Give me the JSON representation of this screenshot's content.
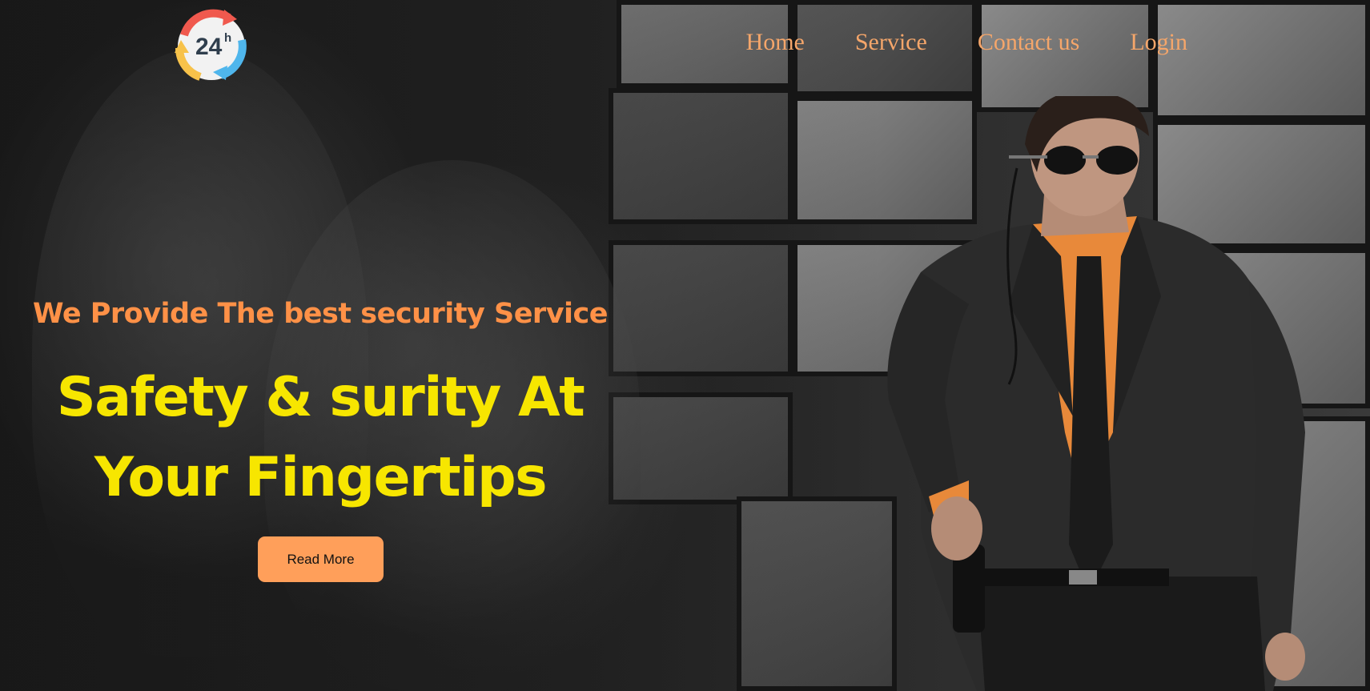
{
  "header": {
    "logo": {
      "text": "24",
      "superscript": "h",
      "icon": "24h-cycle-arrows-icon",
      "colors": {
        "red": "#f0594e",
        "blue": "#4fb6ec",
        "yellow": "#f7c24a",
        "text": "#2f3e4d"
      }
    },
    "nav": [
      {
        "label": "Home"
      },
      {
        "label": "Service"
      },
      {
        "label": "Contact us"
      },
      {
        "label": "Login"
      }
    ]
  },
  "hero": {
    "tagline": "We Provide The best security Service",
    "headline_line1": "Safety & surity At",
    "headline_line2": "Your Fingertips",
    "cta_label": "Read More"
  },
  "colors": {
    "nav_text": "#f5a66a",
    "tagline": "#ff9147",
    "headline": "#f7e600",
    "button_bg": "#ff9f5a",
    "shirt": "#e8893a",
    "background": "#1c1c1c"
  }
}
